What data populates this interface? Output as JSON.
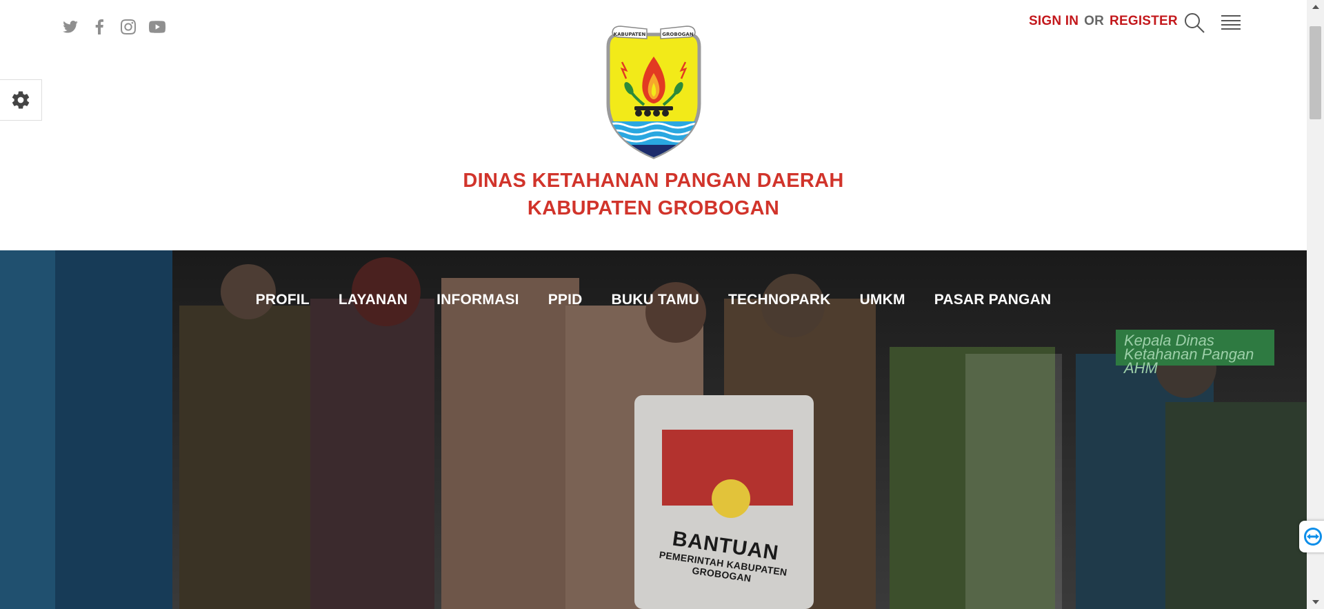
{
  "header": {
    "social_icons": [
      "twitter-icon",
      "facebook-icon",
      "instagram-icon",
      "youtube-icon"
    ],
    "auth": {
      "sign_in": "SIGN IN",
      "or": "OR",
      "register": "REGISTER"
    },
    "logo_lettering": [
      "KABUPATEN",
      "GROBOGAN"
    ],
    "title_line1": "DINAS KETAHANAN PANGAN DAERAH",
    "title_line2": "KABUPATEN GROBOGAN"
  },
  "nav": {
    "items": [
      "PROFIL",
      "LAYANAN",
      "INFORMASI",
      "PPID",
      "BUKU TAMU",
      "TECHNOPARK",
      "UMKM",
      "PASAR PANGAN"
    ]
  },
  "hero": {
    "bag_text_big": "BANTUAN",
    "bag_text_small": "PEMERINTAH KABUPATEN GROBOGAN",
    "sign_text_line1": "Kepala Dinas Ketahanan Pangan",
    "sign_text_line2": "AHM"
  },
  "colors": {
    "accent": "#c3181c",
    "title": "#d1342b",
    "icon_grey": "#8f8f8f"
  }
}
